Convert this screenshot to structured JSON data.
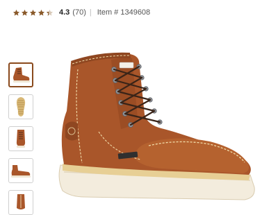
{
  "product": {
    "rating": "4.3",
    "rating_count": "(70)",
    "separator": "|",
    "item_number": "Item # 1349608",
    "stars_filled": 4.3,
    "star_color": "#8a5a2b",
    "star_empty_color": "#d8c9b8"
  },
  "gallery": {
    "thumbnails": [
      {
        "icon": "boot-side-view-icon",
        "selected": true
      },
      {
        "icon": "boot-sole-icon",
        "selected": false
      },
      {
        "icon": "boot-front-view-icon",
        "selected": false
      },
      {
        "icon": "boot-profile-icon",
        "selected": false
      },
      {
        "icon": "boot-back-view-icon",
        "selected": false
      }
    ],
    "main_image": "work-boot-image",
    "boot_color": "#a9562a",
    "sole_color": "#f3ecdd",
    "lace_color": "#3a2418",
    "eyelet_color": "#8e9196"
  }
}
